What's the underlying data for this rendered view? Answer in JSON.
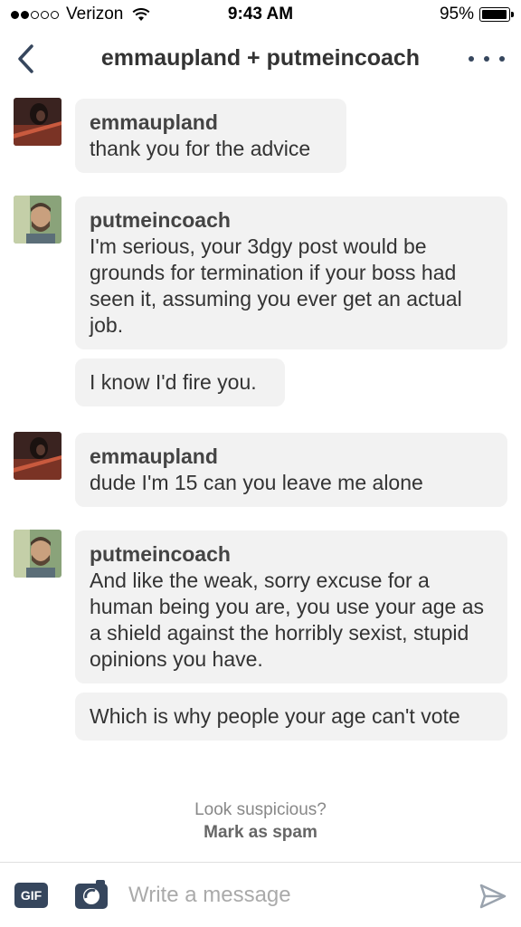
{
  "status_bar": {
    "carrier": "Verizon",
    "time": "9:43 AM",
    "battery": "95%",
    "battery_level": 0.95,
    "signal_bars": 2,
    "signal_total": 5
  },
  "header": {
    "title": "emmaupland + putmeincoach",
    "back_icon": "chevron-left-icon",
    "more_icon": "ellipsis-icon",
    "accent_color": "#36465d"
  },
  "messages": [
    {
      "sender": "emmaupland",
      "avatar": "avatar-emmaupland",
      "bubbles": [
        "thank you for the advice"
      ]
    },
    {
      "sender": "putmeincoach",
      "avatar": "avatar-putmeincoach",
      "bubbles": [
        "I'm serious, your 3dgy post would be grounds for termination if your boss had seen it, assuming you ever get an actual job.",
        "I know I'd fire you."
      ]
    },
    {
      "sender": "emmaupland",
      "avatar": "avatar-emmaupland",
      "bubbles": [
        "dude I'm 15 can you leave me alone"
      ]
    },
    {
      "sender": "putmeincoach",
      "avatar": "avatar-putmeincoach",
      "bubbles": [
        "And like the weak, sorry excuse for a human being you are, you use your age as a shield against the horribly sexist, stupid opinions you have.",
        "Which is why people your age can't vote"
      ]
    }
  ],
  "spam": {
    "question": "Look suspicious?",
    "link": "Mark as spam"
  },
  "compose": {
    "gif_label": "GIF",
    "placeholder": "Write a message",
    "camera_icon": "camera-icon",
    "send_icon": "send-icon"
  }
}
